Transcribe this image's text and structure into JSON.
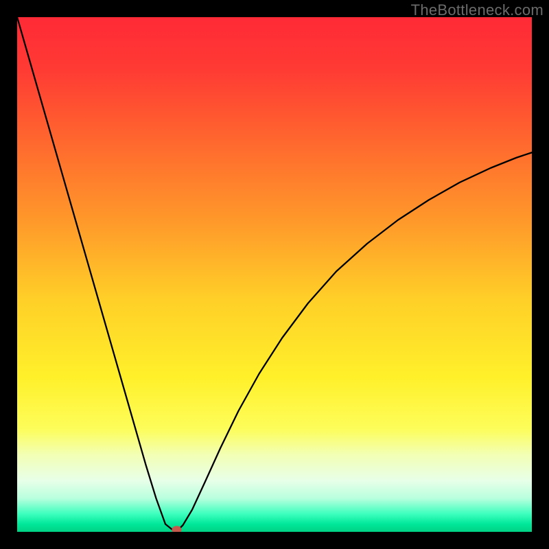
{
  "watermark": "TheBottleneck.com",
  "chart_data": {
    "type": "line",
    "title": "",
    "xlabel": "",
    "ylabel": "",
    "xlim": [
      0,
      100
    ],
    "ylim": [
      0,
      100
    ],
    "grid": false,
    "background_gradient": {
      "stops": [
        {
          "offset": 0.0,
          "color": "#ff2a36"
        },
        {
          "offset": 0.1,
          "color": "#ff3a34"
        },
        {
          "offset": 0.25,
          "color": "#ff6a2e"
        },
        {
          "offset": 0.4,
          "color": "#ff9a2a"
        },
        {
          "offset": 0.55,
          "color": "#ffd028"
        },
        {
          "offset": 0.7,
          "color": "#fff02a"
        },
        {
          "offset": 0.8,
          "color": "#fdfd5a"
        },
        {
          "offset": 0.85,
          "color": "#f2ffb4"
        },
        {
          "offset": 0.9,
          "color": "#e8ffe8"
        },
        {
          "offset": 0.935,
          "color": "#b8ffde"
        },
        {
          "offset": 0.965,
          "color": "#3dffbe"
        },
        {
          "offset": 0.985,
          "color": "#00e89a"
        },
        {
          "offset": 1.0,
          "color": "#00d184"
        }
      ]
    },
    "series": [
      {
        "name": "bottleneck-curve",
        "color": "#000000",
        "x": [
          0.0,
          2.5,
          5.0,
          7.5,
          10.0,
          12.5,
          15.0,
          17.5,
          20.0,
          22.5,
          25.0,
          27.0,
          28.8,
          30.3,
          30.7,
          31.2,
          32.2,
          34.0,
          36.5,
          39.5,
          43.0,
          47.0,
          51.5,
          56.5,
          62.0,
          68.0,
          74.0,
          80.0,
          86.0,
          92.0,
          97.0,
          100.0
        ],
        "y": [
          100.0,
          91.3,
          82.6,
          73.9,
          65.2,
          56.5,
          47.8,
          39.1,
          30.4,
          21.7,
          13.0,
          6.5,
          1.5,
          0.3,
          0.2,
          0.3,
          1.3,
          4.3,
          9.7,
          16.3,
          23.5,
          30.7,
          37.7,
          44.4,
          50.6,
          56.0,
          60.6,
          64.5,
          67.9,
          70.7,
          72.7,
          73.7
        ]
      }
    ],
    "marker": {
      "name": "sweet-spot",
      "x": 31.0,
      "y": 0.4,
      "rx": 0.95,
      "ry": 0.75,
      "color": "#c45a4e"
    }
  }
}
